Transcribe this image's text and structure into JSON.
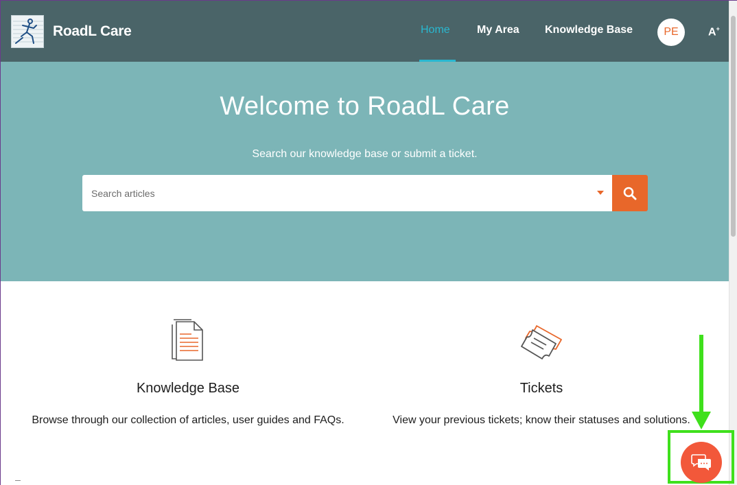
{
  "header": {
    "brand": "RoadL Care",
    "nav": [
      {
        "label": "Home",
        "active": true
      },
      {
        "label": "My Area",
        "active": false
      },
      {
        "label": "Knowledge Base",
        "active": false
      }
    ],
    "avatar_initials": "PE",
    "accessibility_label": "A",
    "accent_color": "#29b8d0"
  },
  "hero": {
    "title": "Welcome to RoadL Care",
    "subtitle": "Search our knowledge base or submit a ticket.",
    "search_placeholder": "Search articles",
    "search_button_color": "#e8672a"
  },
  "cards": [
    {
      "title": "Knowledge Base",
      "description": "Browse through our collection of articles, user guides and FAQs.",
      "icon": "document-icon"
    },
    {
      "title": "Tickets",
      "description": "View your previous tickets; know their statuses and solutions.",
      "icon": "ticket-icon"
    }
  ],
  "chat": {
    "icon": "chat-bubble-icon",
    "color": "#f2583a"
  },
  "annotation": {
    "color": "#3fe01c"
  }
}
